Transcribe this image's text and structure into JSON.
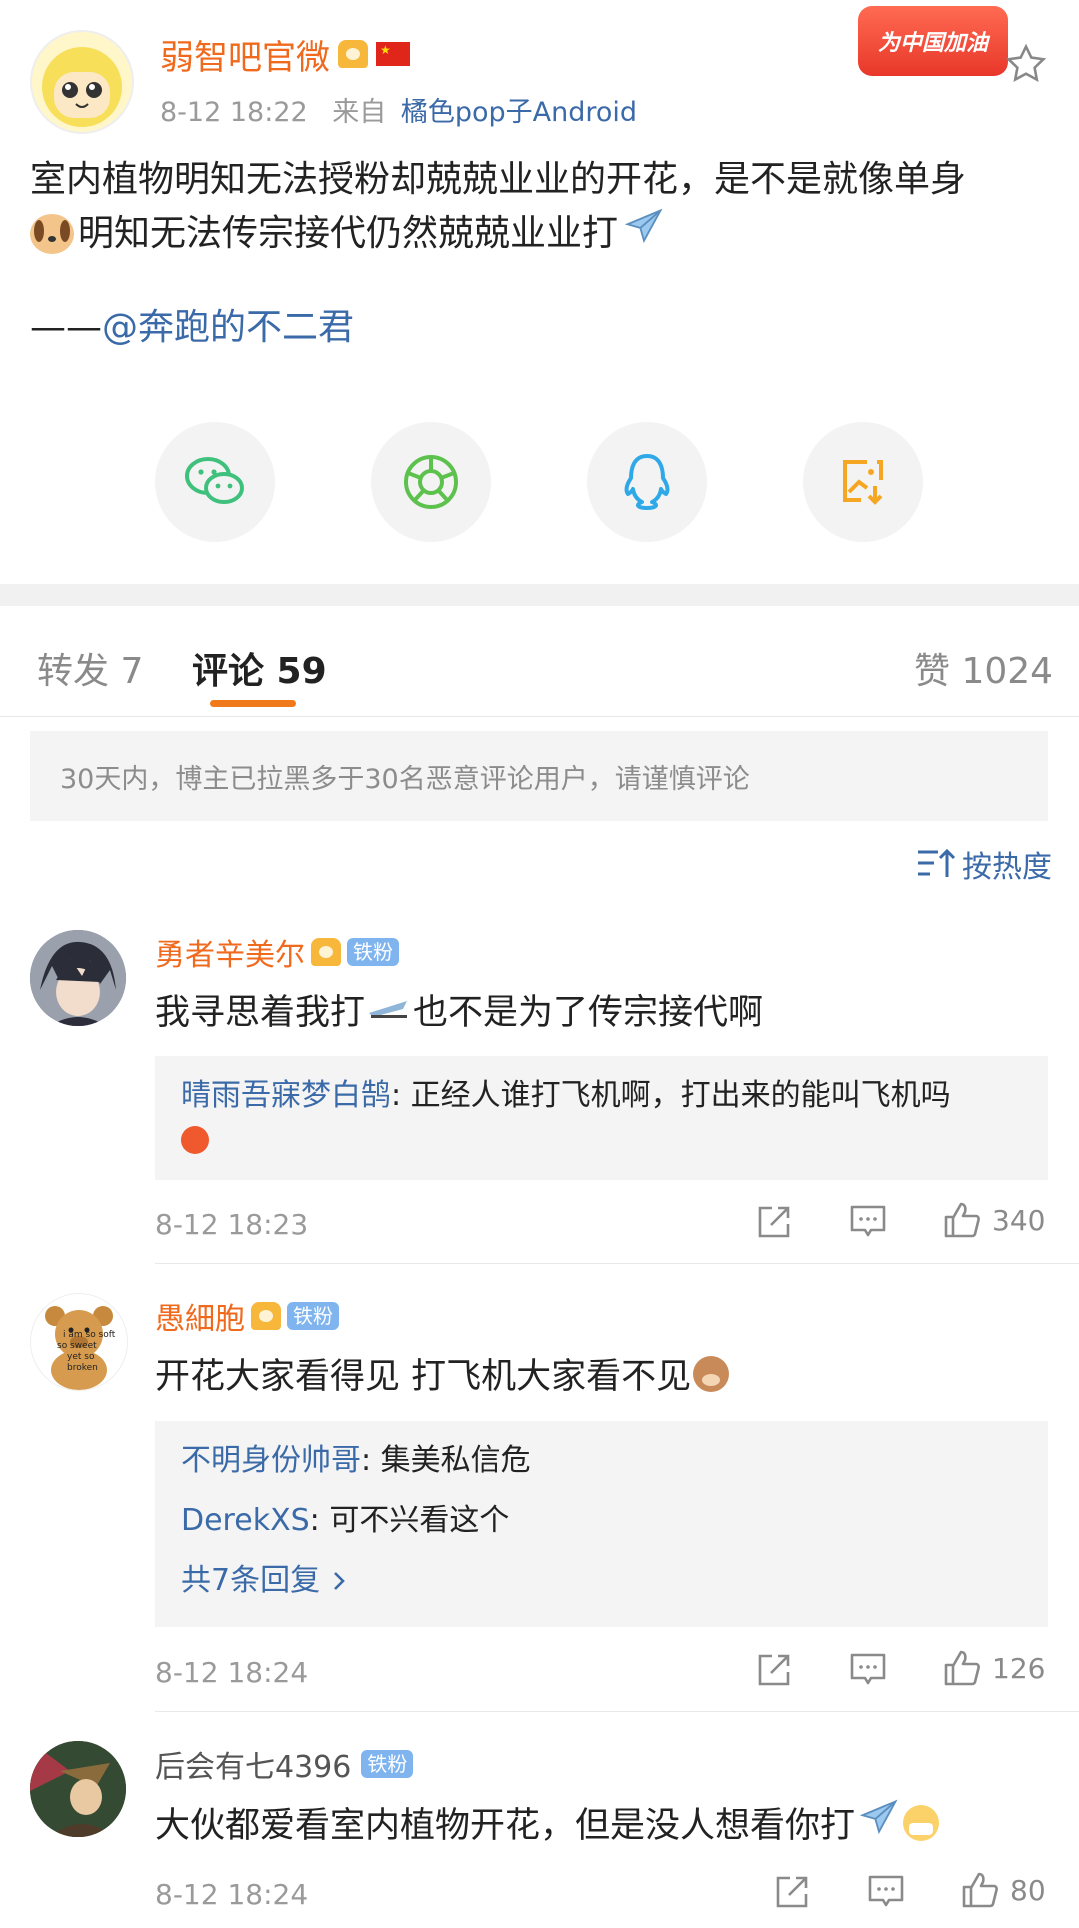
{
  "post": {
    "author_name": "弱智吧官微",
    "time": "8-12 18:22",
    "source_prefix": "来自",
    "source": "橘色pop子Android",
    "promo_badge": "为中国加油",
    "text_line1": "室内植物明知无法授粉却兢兢业业的开花，是不是就像单身",
    "text_line2": "明知无法传宗接代仍然兢兢业业打",
    "credit_dash": "——",
    "credit_user": "@奔跑的不二君"
  },
  "share_buttons": [
    {
      "icon": "wechat-icon"
    },
    {
      "icon": "moments-icon"
    },
    {
      "icon": "qq-icon"
    },
    {
      "icon": "save-image-icon"
    }
  ],
  "tabs": {
    "repost": "转发 7",
    "comment": "评论 59",
    "like": "赞 1024"
  },
  "notice": "30天内，博主已拉黑多于30名恶意评论用户，请谨慎评论",
  "sort_label": "按热度",
  "comments": [
    {
      "name": "勇者辛美尔",
      "badge": "铁粉",
      "crown_level": "4",
      "text": "我寻思着我打",
      "text_after": "也不是为了传宗接代啊",
      "replies": [
        {
          "user": "晴雨吾寐梦白鹄",
          "text": ": 正经人谁打飞机啊，打出来的能叫飞机吗"
        }
      ],
      "time": "8-12 18:23",
      "likes": "340"
    },
    {
      "name": "愚細胞",
      "badge": "铁粉",
      "crown_level": "6",
      "text": "开花大家看得见 打飞机大家看不见",
      "replies": [
        {
          "user": "不明身份帅哥",
          "text": ": 集美私信危"
        },
        {
          "user": "DerekXS",
          "text": ": 可不兴看这个"
        }
      ],
      "more_replies": "共7条回复",
      "time": "8-12 18:24",
      "likes": "126"
    },
    {
      "name": "后会有七4396",
      "badge": "铁粉",
      "text": "大伙都爱看室内植物开花，但是没人想看你打",
      "time": "8-12 18:24",
      "likes": "80"
    }
  ],
  "bear_avatar_text": [
    "i am so soft",
    "so sweet",
    "yet so broken"
  ],
  "colors": {
    "accent": "#f07a1a",
    "link": "#3b6aa8",
    "orange_name": "#f06a1e"
  }
}
